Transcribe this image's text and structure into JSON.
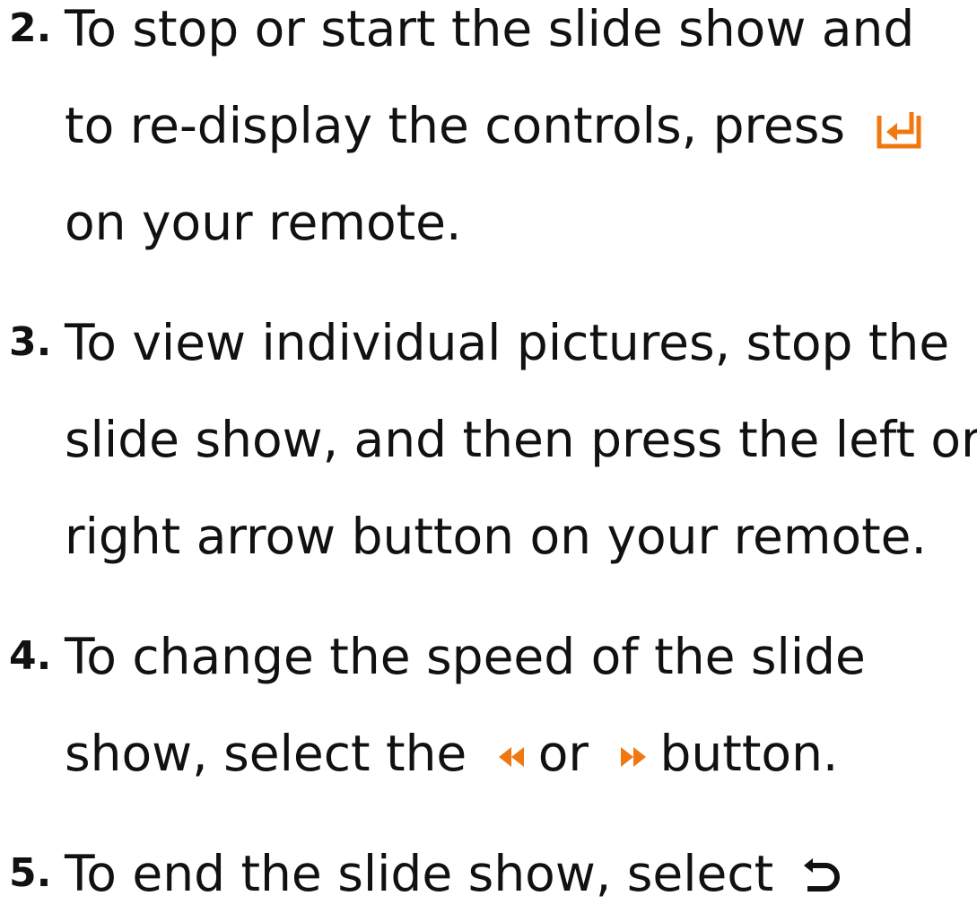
{
  "steps": [
    {
      "number": "2.",
      "lines": [
        "To stop or start the slide show and",
        "to re-display the controls, press",
        "on your remote."
      ]
    },
    {
      "number": "3.",
      "lines": [
        "To view individual pictures, stop the",
        "slide show, and then press the left or",
        "right arrow button on your remote."
      ]
    },
    {
      "number": "4.",
      "lines": [
        "To change the speed of the slide",
        "show, select the",
        "or",
        "button."
      ]
    },
    {
      "number": "5.",
      "lines": [
        "To end the slide show, select"
      ]
    }
  ],
  "icons": {
    "enter": "enter-icon",
    "rewind": "rewind-icon",
    "fast_forward": "fast-forward-icon",
    "return": "return-icon"
  },
  "colors": {
    "text": "#111111",
    "accent": "#f07810"
  }
}
